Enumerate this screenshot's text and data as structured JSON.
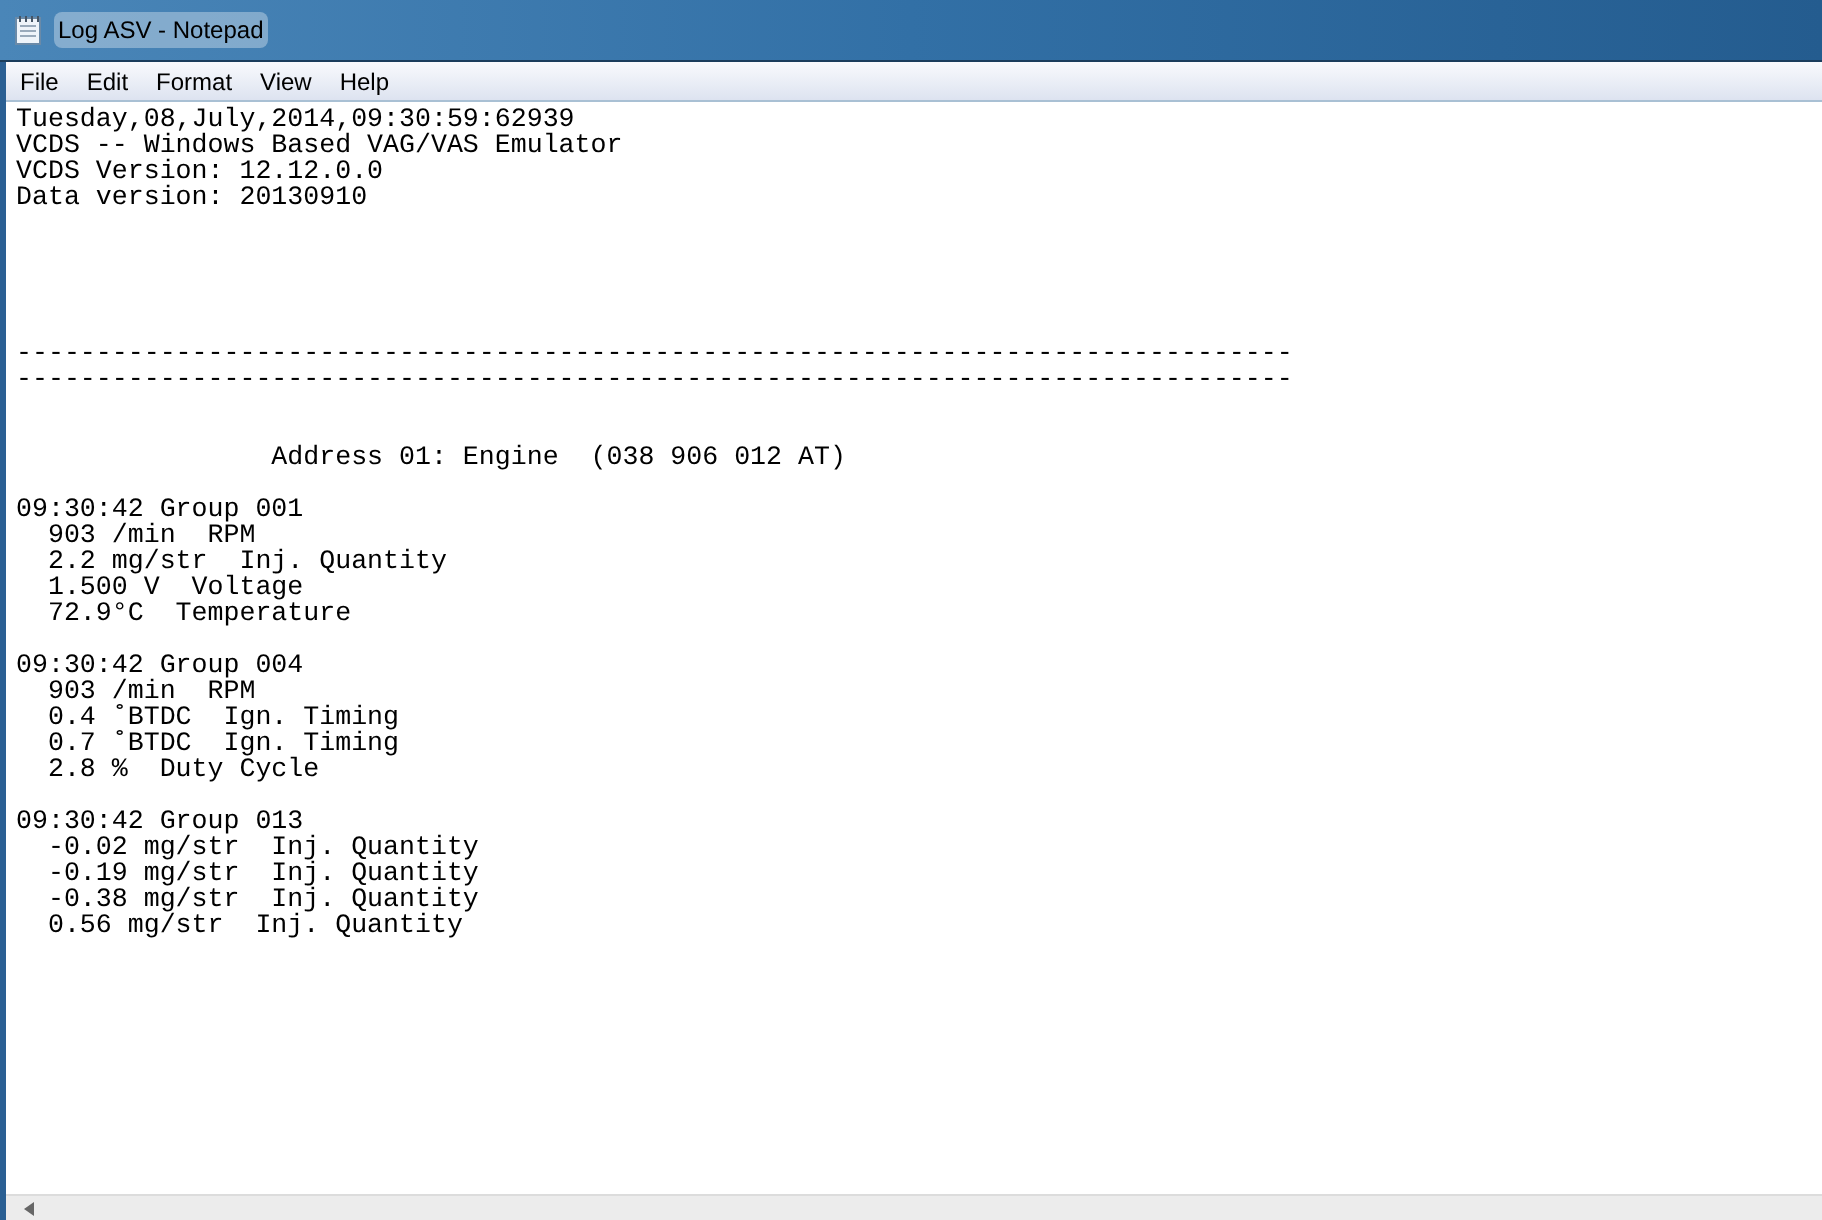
{
  "window": {
    "title": "Log ASV - Notepad"
  },
  "menu": [
    "File",
    "Edit",
    "Format",
    "View",
    "Help"
  ],
  "lines": [
    {
      "kind": "text",
      "text": "Tuesday,08,July,2014,09:30:59:62939"
    },
    {
      "kind": "text",
      "text": "VCDS -- Windows Based VAG/VAS Emulator"
    },
    {
      "kind": "text",
      "text": "VCDS Version: 12.12.0.0"
    },
    {
      "kind": "text",
      "text": "Data version: 20130910"
    },
    {
      "kind": "blank"
    },
    {
      "kind": "blank"
    },
    {
      "kind": "blank"
    },
    {
      "kind": "blank"
    },
    {
      "kind": "blank"
    },
    {
      "kind": "text",
      "text": "--------------------------------------------------------------------------------"
    },
    {
      "kind": "text",
      "text": "--------------------------------------------------------------------------------"
    },
    {
      "kind": "blank"
    },
    {
      "kind": "blank"
    },
    {
      "kind": "text",
      "text": "                Address 01: Engine  (038 906 012 AT)"
    },
    {
      "kind": "blank"
    },
    {
      "kind": "text",
      "text": "09:30:42 Group 001"
    },
    {
      "kind": "text",
      "text": "  903 /min  RPM"
    },
    {
      "kind": "text",
      "text": "  2.2 mg/str  Inj. Quantity"
    },
    {
      "kind": "text",
      "text": "  1.500 V  Voltage"
    },
    {
      "kind": "text",
      "text": "  72.9°C  Temperature"
    },
    {
      "kind": "blank"
    },
    {
      "kind": "text",
      "text": "09:30:42 Group 004"
    },
    {
      "kind": "text",
      "text": "  903 /min  RPM"
    },
    {
      "kind": "text",
      "text": "  0.4 ˚BTDC  Ign. Timing"
    },
    {
      "kind": "text",
      "text": "  0.7 ˚BTDC  Ign. Timing"
    },
    {
      "kind": "text",
      "text": "  2.8 %  Duty Cycle"
    },
    {
      "kind": "blank"
    },
    {
      "kind": "text",
      "text": "09:30:42 Group 013"
    },
    {
      "kind": "text",
      "text": "  -0.02 mg/str  Inj. Quantity"
    },
    {
      "kind": "text",
      "text": "  -0.19 mg/str  Inj. Quantity"
    },
    {
      "kind": "text",
      "text": "  -0.38 mg/str  Inj. Quantity"
    },
    {
      "kind": "text",
      "text": "  0.56 mg/str  Inj. Quantity"
    }
  ]
}
